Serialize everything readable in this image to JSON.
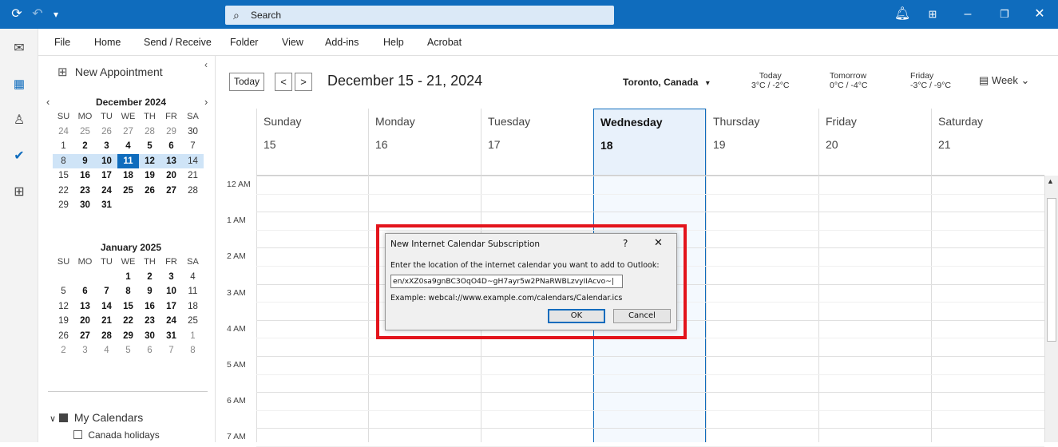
{
  "colors": {
    "accent": "#0f6cbd",
    "highlight": "#e3141c"
  },
  "titlebar": {
    "search_placeholder": "Search",
    "icons": [
      "sync-icon",
      "undo-icon",
      "customize-icon",
      "bell-icon",
      "ribbon-display-icon",
      "minimize-icon",
      "restore-icon",
      "close-icon"
    ]
  },
  "rail": [
    "mail-icon",
    "calendar-icon",
    "people-icon",
    "todo-icon",
    "apps-icon"
  ],
  "menu": [
    "File",
    "Home",
    "Send / Receive",
    "Folder",
    "View",
    "Add-ins",
    "Help",
    "Acrobat"
  ],
  "sidebar": {
    "new_appointment": "New Appointment",
    "weekday_headers": [
      "SU",
      "MO",
      "TU",
      "WE",
      "TH",
      "FR",
      "SA"
    ],
    "month1": {
      "title": "December 2024",
      "days": [
        "24",
        "25",
        "26",
        "27",
        "28",
        "29",
        "30",
        "1",
        "2",
        "3",
        "4",
        "5",
        "6",
        "7",
        "8",
        "9",
        "10",
        "11",
        "12",
        "13",
        "14",
        "15",
        "16",
        "17",
        "18",
        "19",
        "20",
        "21",
        "22",
        "23",
        "24",
        "25",
        "26",
        "27",
        "28",
        "29",
        "30",
        "31"
      ]
    },
    "month2": {
      "title": "January 2025",
      "days": [
        "1",
        "2",
        "3",
        "4",
        "5",
        "6",
        "7",
        "8",
        "9",
        "10",
        "11",
        "12",
        "13",
        "14",
        "15",
        "16",
        "17",
        "18",
        "19",
        "20",
        "21",
        "22",
        "23",
        "24",
        "25",
        "26",
        "27",
        "28",
        "29",
        "30",
        "31",
        "1",
        "2",
        "3",
        "4",
        "5",
        "6",
        "7",
        "8"
      ]
    },
    "my_calendars": "My Calendars",
    "canada_holidays": "Canada holidays"
  },
  "calendar": {
    "today_btn": "Today",
    "prev": "<",
    "next": ">",
    "range": "December 15 - 21, 2024",
    "location": "Toronto, Canada",
    "weather": [
      {
        "day": "Today",
        "temp": "3°C / -2°C"
      },
      {
        "day": "Tomorrow",
        "temp": "0°C / -4°C"
      },
      {
        "day": "Friday",
        "temp": "-3°C / -9°C"
      }
    ],
    "view": "Week",
    "days": [
      {
        "name": "Sunday",
        "date": "15"
      },
      {
        "name": "Monday",
        "date": "16"
      },
      {
        "name": "Tuesday",
        "date": "17"
      },
      {
        "name": "Wednesday",
        "date": "18"
      },
      {
        "name": "Thursday",
        "date": "19"
      },
      {
        "name": "Friday",
        "date": "20"
      },
      {
        "name": "Saturday",
        "date": "21"
      }
    ],
    "times": [
      "12 AM",
      "1 AM",
      "2 AM",
      "3 AM",
      "4 AM",
      "5 AM",
      "6 AM",
      "7 AM"
    ]
  },
  "dialog": {
    "title": "New Internet Calendar Subscription",
    "help": "?",
    "close": "✕",
    "prompt": "Enter the location of the internet calendar you want to add to Outlook:",
    "url_value": "en/xXZ0sa9gnBC3OqO4D~gH7ayr5w2PNaRWBLzvyIIAcvo~|",
    "example": "Example: webcal://www.example.com/calendars/Calendar.ics",
    "ok": "OK",
    "cancel": "Cancel"
  }
}
